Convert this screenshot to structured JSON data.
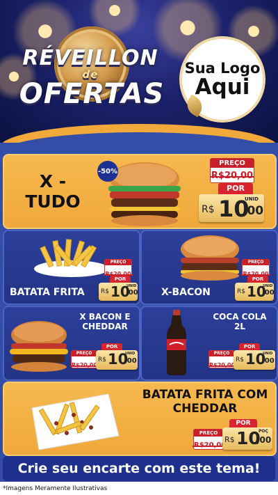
{
  "header": {
    "title_line1": "RÉVEILLON",
    "title_line2": "de",
    "title_line3": "OFERTAS",
    "logo_line1": "Sua Logo",
    "logo_line2": "Aqui"
  },
  "featured": {
    "name_line1": "X -",
    "name_line2": "TUDO",
    "discount": "-50%",
    "preco_label": "PREÇO",
    "old_price": "R$20,00",
    "por_label": "POR",
    "currency": "R$",
    "price_int": "10",
    "price_cents": ",00",
    "unit": "UNID"
  },
  "products": [
    {
      "name": "BATATA FRITA",
      "preco_label": "PREÇO",
      "old_price": "R$20,00",
      "por_label": "POR",
      "currency": "R$",
      "price_int": "10",
      "price_cents": ",00",
      "unit": "UNID"
    },
    {
      "name": "X-BACON",
      "preco_label": "PREÇO",
      "old_price": "R$20,00",
      "por_label": "POR",
      "currency": "R$",
      "price_int": "10",
      "price_cents": ",00",
      "unit": "UNID"
    },
    {
      "name_line1": "X BACON E",
      "name_line2": "CHEDDAR",
      "preco_label": "PREÇO",
      "old_price": "R$20,00",
      "por_label": "POR",
      "currency": "R$",
      "price_int": "10",
      "price_cents": ",00",
      "unit": "UNID"
    },
    {
      "name_line1": "COCA COLA",
      "name_line2": "2L",
      "preco_label": "PREÇO",
      "old_price": "R$20,00",
      "por_label": "POR",
      "currency": "R$",
      "price_int": "10",
      "price_cents": ",00",
      "unit": "UNID"
    },
    {
      "name_line1": "BATATA FRITA COM",
      "name_line2": "CHEDDAR",
      "preco_label": "PREÇO",
      "old_price": "R$20,00",
      "por_label": "POR",
      "currency": "R$",
      "price_int": "10",
      "price_cents": ",00",
      "unit": "POÇ"
    }
  ],
  "cta": "Crie seu encarte com este tema!",
  "disclaimer": "*Imagens Meramente Ilustrativas",
  "colors": {
    "navy": "#1c226b",
    "orange": "#f0a83b",
    "blue": "#344ea8",
    "red": "#c8202b",
    "gold": "#e6b95a"
  }
}
